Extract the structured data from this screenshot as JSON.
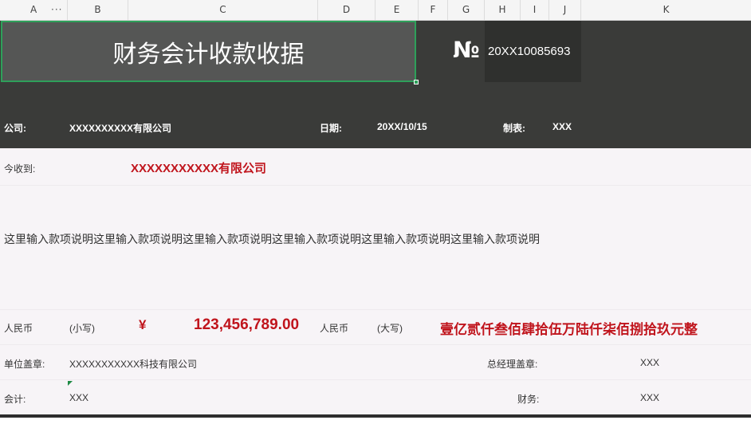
{
  "columns": [
    "A",
    "B",
    "C",
    "D",
    "E",
    "F",
    "G",
    "H",
    "I",
    "J",
    "K"
  ],
  "header": {
    "title": "财务会计收款收据",
    "number_symbol": "№",
    "number_value": "20XX10085693"
  },
  "info": {
    "company_label": "公司:",
    "company_value": "XXXXXXXXXX有限公司",
    "date_label": "日期:",
    "date_value": "20XX/10/15",
    "maker_label": "制表:",
    "maker_value": "XXX"
  },
  "receipt": {
    "received_label": "今收到:",
    "received_value": "XXXXXXXXXXX有限公司",
    "description": "这里输入款项说明这里输入款项说明这里输入款项说明这里输入款项说明这里输入款项说明这里输入款项说明"
  },
  "amount": {
    "rmb_label_1": "人民币",
    "small_label": "(小写)",
    "yen_symbol": "¥",
    "small_value": "123,456,789.00",
    "rmb_label_2": "人民币",
    "big_label": "(大写)",
    "big_value": "壹亿贰仟叁佰肆拾伍万陆仟柒佰捌拾玖元整"
  },
  "footer": {
    "seal_label": "单位盖章:",
    "seal_value": "XXXXXXXXXXX科技有限公司",
    "gm_label": "总经理盖章:",
    "gm_value": "XXX",
    "accountant_label": "会计:",
    "accountant_value": "XXX",
    "finance_label": "财务:",
    "finance_value": "XXX"
  },
  "colors": {
    "dark_bg": "#3a3b39",
    "title_bg": "#555655",
    "selection": "#2ea05a",
    "red": "#c0141c",
    "body_bg": "#f7f4f7"
  }
}
